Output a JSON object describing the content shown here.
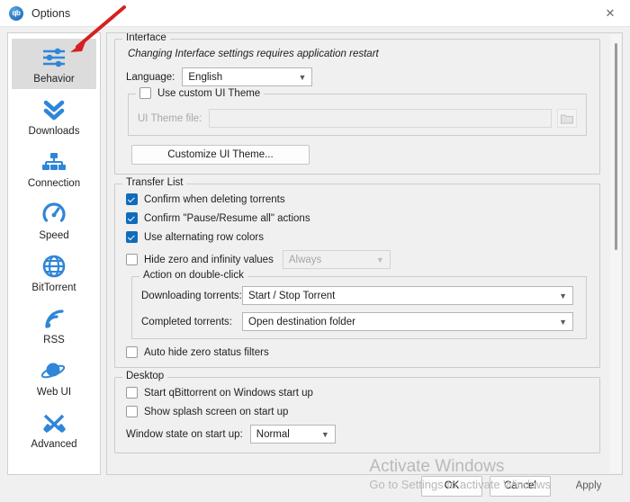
{
  "window": {
    "title": "Options",
    "logo_icon": "qbittorrent-logo-icon",
    "logo_text": "qb",
    "close_icon": "close-icon",
    "close_glyph": "✕"
  },
  "sidebar": {
    "items": [
      {
        "label": "Behavior",
        "icon": "sliders-icon",
        "selected": true
      },
      {
        "label": "Downloads",
        "icon": "double-chevron-down-icon",
        "selected": false
      },
      {
        "label": "Connection",
        "icon": "network-icon",
        "selected": false
      },
      {
        "label": "Speed",
        "icon": "speedometer-icon",
        "selected": false
      },
      {
        "label": "BitTorrent",
        "icon": "globe-icon",
        "selected": false
      },
      {
        "label": "RSS",
        "icon": "rss-icon",
        "selected": false
      },
      {
        "label": "Web UI",
        "icon": "planet-icon",
        "selected": false
      },
      {
        "label": "Advanced",
        "icon": "tools-icon",
        "selected": false
      }
    ]
  },
  "interface": {
    "group_title": "Interface",
    "restart_note": "Changing Interface settings requires application restart",
    "language_label": "Language:",
    "language_value": "English",
    "use_custom_theme_label": "Use custom UI Theme",
    "use_custom_theme_checked": false,
    "theme_file_label": "UI Theme file:",
    "theme_file_value": "",
    "browse_icon": "folder-icon",
    "customize_button": "Customize UI Theme..."
  },
  "transfer_list": {
    "group_title": "Transfer List",
    "confirm_delete_label": "Confirm when deleting torrents",
    "confirm_delete_checked": true,
    "confirm_pause_label": "Confirm \"Pause/Resume all\" actions",
    "confirm_pause_checked": true,
    "alternating_rows_label": "Use alternating row colors",
    "alternating_rows_checked": true,
    "hide_zero_label": "Hide zero and infinity values",
    "hide_zero_checked": false,
    "hide_zero_value": "Always",
    "double_click": {
      "group_title": "Action on double-click",
      "downloading_label": "Downloading torrents:",
      "downloading_value": "Start / Stop Torrent",
      "completed_label": "Completed torrents:",
      "completed_value": "Open destination folder"
    },
    "auto_hide_label": "Auto hide zero status filters",
    "auto_hide_checked": false
  },
  "desktop": {
    "group_title": "Desktop",
    "start_on_windows_label": "Start qBittorrent on Windows start up",
    "start_on_windows_checked": false,
    "splash_label": "Show splash screen on start up",
    "splash_checked": false,
    "window_state_label": "Window state on start up:",
    "window_state_value": "Normal"
  },
  "footer": {
    "ok": "OK",
    "cancel": "Cancel",
    "apply": "Apply"
  },
  "watermark": {
    "line1": "Activate Windows",
    "line2": "Go to Settings to activate Windows"
  },
  "annotation": {
    "arrow_icon": "red-arrow-annotation",
    "color": "#d42121"
  },
  "colors": {
    "accent_blue": "#2f86d8",
    "checkbox_blue": "#0f6cbd",
    "window_bg": "#f0f0f0"
  }
}
